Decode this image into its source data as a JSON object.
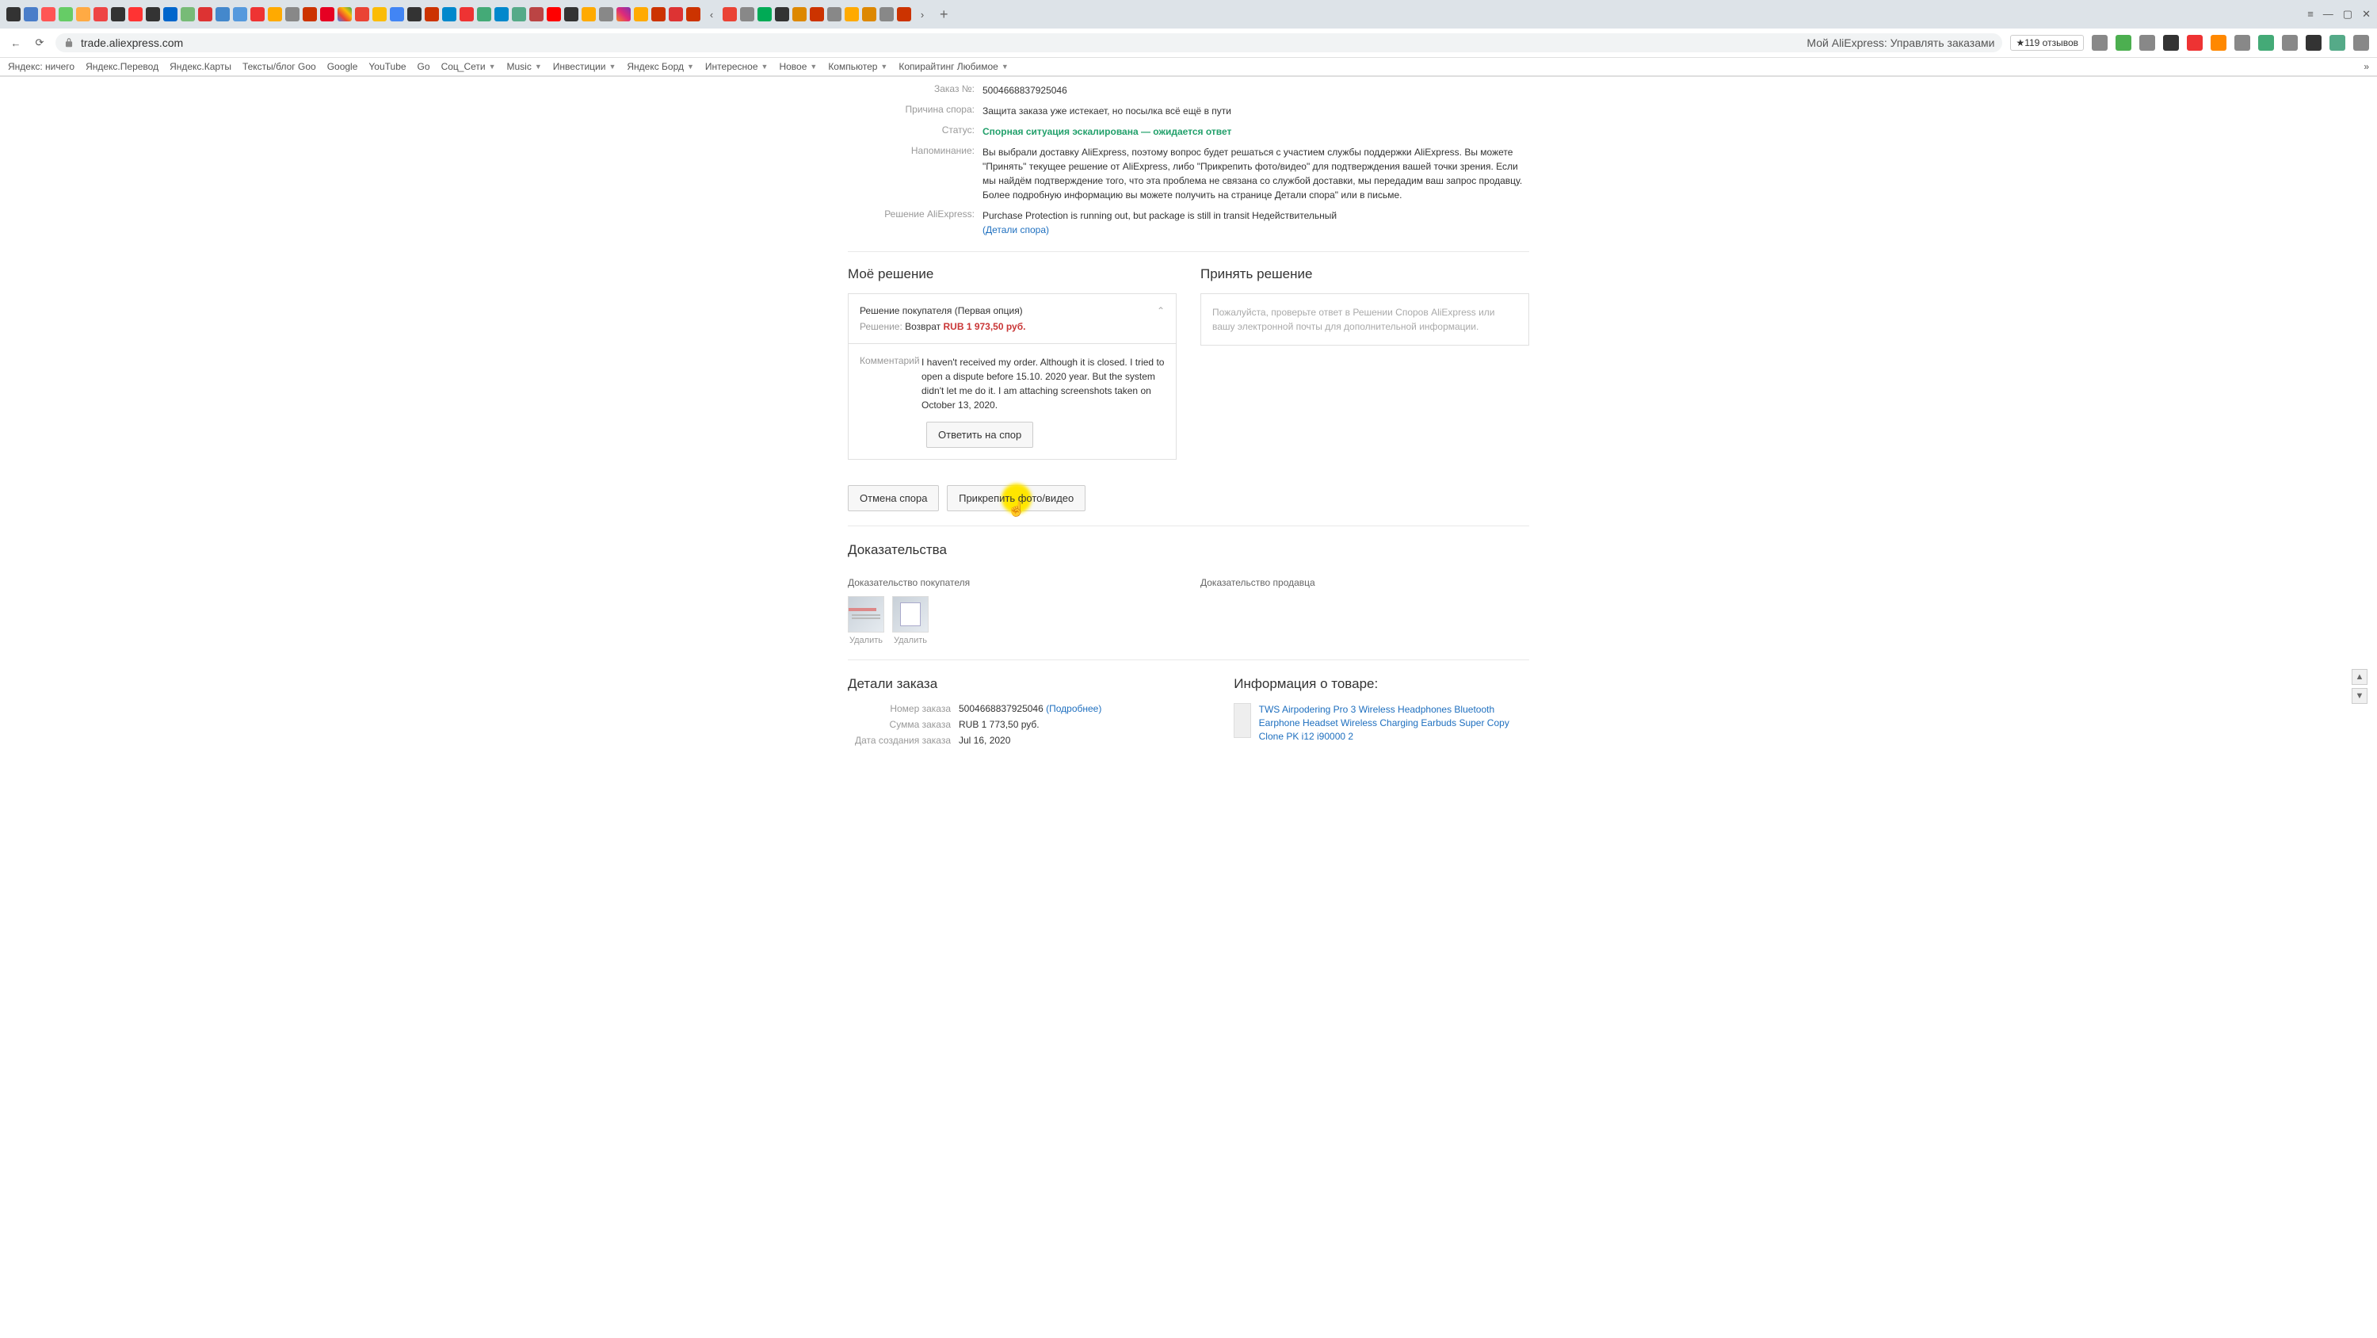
{
  "browser": {
    "url": "trade.aliexpress.com",
    "page_title": "Мой AliExpress: Управлять заказами",
    "reviews_badge": "★119 отзывов",
    "new_tab": "+"
  },
  "bookmarks": [
    "Яндекс: ничего",
    "Яндекс.Перевод",
    "Яндекс.Карты",
    "Тексты/блог Goo",
    "Google",
    "YouTube",
    "Go",
    "Соц_Сети",
    "Music",
    "Инвестиции",
    "Яндекс Борд",
    "Интересное",
    "Новое",
    "Компьютер",
    "Копирайтинг Любимое"
  ],
  "dispute": {
    "order_label": "Заказ №:",
    "order_value": "5004668837925046",
    "reason_label": "Причина спора:",
    "reason_value": "Защита заказа уже истекает, но посылка всё ещё в пути",
    "status_label": "Статус:",
    "status_value": "Спорная ситуация эскалирована — ожидается ответ",
    "reminder_label": "Напоминание:",
    "reminder_value": "Вы выбрали доставку AliExpress, поэтому вопрос будет решаться с участием службы поддержки AliExpress. Вы можете \"Принять\" текущее решение от AliExpress, либо \"Прикрепить фото/видео\" для подтверждения вашей точки зрения. Если мы найдём подтверждение того, что эта проблема не связана со службой доставки, мы передадим ваш запрос продавцу. Более подробную информацию вы можете получить на странице Детали спора\" или в письме.",
    "solution_label": "Решение AliExpress:",
    "solution_value": "Purchase Protection is running out, but package is still in transit  Недействительный",
    "solution_link": "(Детали спора)"
  },
  "my_solution": {
    "title": "Моё решение",
    "card_title": "Решение покупателя (Первая опция)",
    "row_label": "Решение:",
    "row_value_prefix": "Возврат ",
    "row_value_amount": "RUB 1 973,50 руб.",
    "comment_label": "Комментарий",
    "comment_text": "I haven't received my order. Although it is closed. I tried to open a dispute before 15.10. 2020 year. But the system didn't let me do it. I am attaching screenshots taken on October 13, 2020.",
    "reply_btn": "Ответить на спор"
  },
  "accept": {
    "title": "Принять решение",
    "note": "Пожалуйста, проверьте ответ в Решении Споров AliExpress или вашу электронной почты для дополнительной информации."
  },
  "actions": {
    "cancel": "Отмена спора",
    "attach": "Прикрепить фото/видео"
  },
  "evidence": {
    "title": "Доказательства",
    "buyer_label": "Доказательство покупателя",
    "seller_label": "Доказательство продавца",
    "delete": "Удалить"
  },
  "order_details": {
    "title": "Детали заказа",
    "num_label": "Номер заказа",
    "num_value": "5004668837925046",
    "num_more": "(Подробнее)",
    "sum_label": "Сумма заказа",
    "sum_value": "RUB 1 773,50 руб.",
    "date_label": "Дата создания заказа",
    "date_value": "Jul 16, 2020"
  },
  "product": {
    "title": "Информация о товаре:",
    "name": "TWS Airpodering Pro 3 Wireless Headphones Bluetooth Earphone Headset Wireless Charging Earbuds Super Copy Clone PK i12 i90000 2"
  }
}
